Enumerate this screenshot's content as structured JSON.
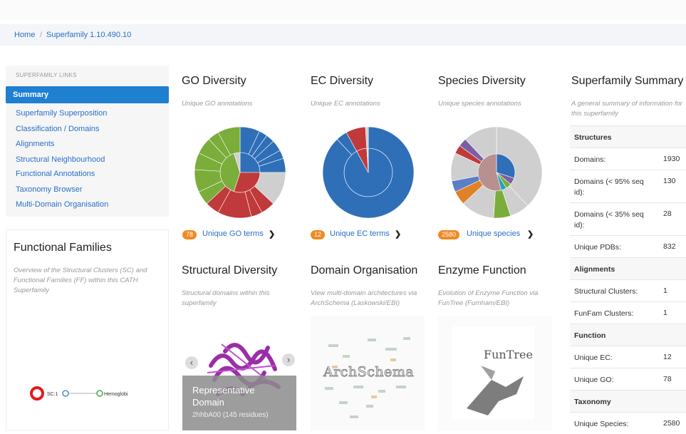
{
  "breadcrumb": {
    "home": "Home",
    "separator": "/",
    "current": "Superfamily 1.10.490.10"
  },
  "sidebar": {
    "heading": "SUPERFAMILY LINKS",
    "active": "Summary",
    "items": [
      {
        "label": "Superfamily Superposition"
      },
      {
        "label": "Classification / Domains"
      },
      {
        "label": "Alignments"
      },
      {
        "label": "Structural Neighbourhood"
      },
      {
        "label": "Functional Annotations"
      },
      {
        "label": "Taxonomy Browser"
      },
      {
        "label": "Multi-Domain Organisation"
      }
    ]
  },
  "functional_families": {
    "title": "Functional Families",
    "description": "Overview of the Structural Clusters (SC) and Functional Families (FF) within this CATH Superfamily",
    "graph": {
      "node_sc": "SC:1",
      "node_ff": "Hemoglobi"
    }
  },
  "go": {
    "title": "GO Diversity",
    "desc": "Unique GO annotations",
    "count": "78",
    "link": "Unique GO terms",
    "chevron": "❯"
  },
  "ec": {
    "title": "EC Diversity",
    "desc": "Unique EC annotations",
    "count": "12",
    "link": "Unique EC terms",
    "chevron": "❯"
  },
  "species": {
    "title": "Species Diversity",
    "desc": "Unique species annotations",
    "count": "2580",
    "link": "Unique species",
    "chevron": "❯"
  },
  "structural": {
    "title": "Structural Diversity",
    "desc": "Structural domains within this superfamily",
    "rep_label": "Representative Domain",
    "rep_sub": "2hhbA00 (145 residues)",
    "prev": "‹",
    "next": "›"
  },
  "domain_org": {
    "title": "Domain Organisation",
    "desc": "View multi-domain architectures via ArchSchema (Laskowski/EBI)",
    "logo_text": "ArchSchema"
  },
  "enzyme": {
    "title": "Enzyme Function",
    "desc": "Evolution of Enzyme Function via FunTree (Furnham/EBI)",
    "logo_text": "FunTree"
  },
  "summary": {
    "title": "Superfamily Summary",
    "desc": "A general summary of information for this superfamily",
    "sections": {
      "structures": "Structures",
      "alignments": "Alignments",
      "function": "Function",
      "taxonomy": "Taxonomy"
    },
    "rows": {
      "domains": {
        "label": "Domains:",
        "value": "1930"
      },
      "domains95": {
        "label": "Domains (< 95% seq id):",
        "value": "130"
      },
      "domains35": {
        "label": "Domains (< 35% seq id):",
        "value": "28"
      },
      "pdbs": {
        "label": "Unique PDBs:",
        "value": "832"
      },
      "structural_clusters": {
        "label": "Structural Clusters:",
        "value": "1"
      },
      "funfam_clusters": {
        "label": "FunFam Clusters:",
        "value": "1"
      },
      "unique_ec": {
        "label": "Unique EC:",
        "value": "12"
      },
      "unique_go": {
        "label": "Unique GO:",
        "value": "78"
      },
      "unique_species": {
        "label": "Unique Species:",
        "value": "2580"
      }
    }
  },
  "colors": {
    "accent": "#1f7fd1",
    "link": "#2a6fc9",
    "badge": "#f08a24",
    "blue": "#2f6fb8",
    "red": "#c0393b",
    "green": "#7aad3a",
    "grey": "#cfcfcf",
    "purple": "#9b2ea8"
  }
}
